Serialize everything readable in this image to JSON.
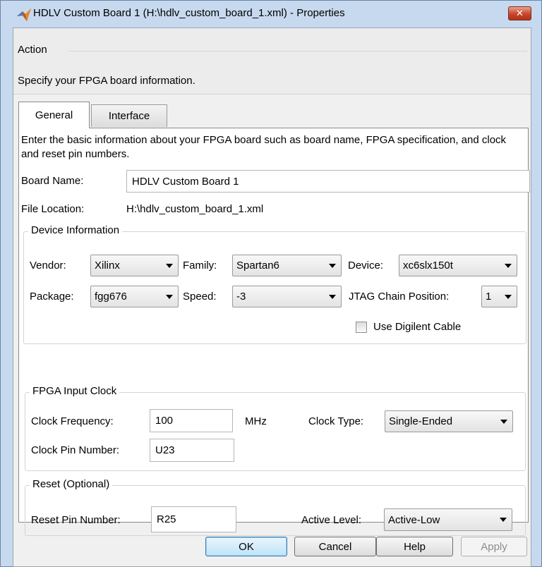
{
  "window": {
    "title": "HDLV Custom Board 1 (H:\\hdlv_custom_board_1.xml) - Properties",
    "close_label": "✕"
  },
  "action": {
    "legend": "Action",
    "text": "Specify your FPGA board information."
  },
  "tabs": [
    {
      "label": "General",
      "selected": true
    },
    {
      "label": "Interface",
      "selected": false
    }
  ],
  "general": {
    "intro": "Enter the basic information about your FPGA board such as board name, FPGA specification, and clock and reset pin numbers.",
    "board_name_label": "Board Name:",
    "board_name_value": "HDLV Custom Board 1",
    "file_location_label": "File Location:",
    "file_location_value": "H:\\hdlv_custom_board_1.xml"
  },
  "device_info": {
    "legend": "Device Information",
    "vendor_label": "Vendor:",
    "vendor_value": "Xilinx",
    "family_label": "Family:",
    "family_value": "Spartan6",
    "device_label": "Device:",
    "device_value": "xc6slx150t",
    "package_label": "Package:",
    "package_value": "fgg676",
    "speed_label": "Speed:",
    "speed_value": "-3",
    "jtag_label": "JTAG Chain Position:",
    "jtag_value": "1",
    "digilent_label": "Use Digilent Cable",
    "digilent_checked": false
  },
  "clock": {
    "legend": "FPGA Input Clock",
    "freq_label": "Clock Frequency:",
    "freq_value": "100",
    "freq_unit": "MHz",
    "type_label": "Clock Type:",
    "type_value": "Single-Ended",
    "pin_label": "Clock Pin Number:",
    "pin_value": "U23"
  },
  "reset": {
    "legend": "Reset (Optional)",
    "pin_label": "Reset Pin Number:",
    "pin_value": "R25",
    "level_label": "Active Level:",
    "level_value": "Active-Low"
  },
  "buttons": {
    "ok": "OK",
    "cancel": "Cancel",
    "help": "Help",
    "apply": "Apply"
  },
  "colors": {
    "title_bg": "#c6d9ee",
    "close_red": "#c8452b",
    "default_button": "#bfe3f8"
  }
}
